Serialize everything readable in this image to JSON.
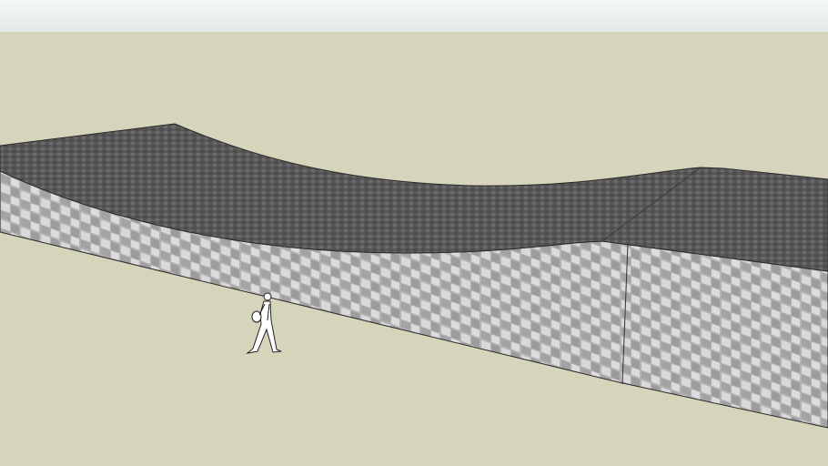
{
  "colors": {
    "sky_top": "#f4f7f8",
    "sky_bottom": "#e3e8e8",
    "ground": "#d6d4bb",
    "roof": "#585858",
    "roof_tile": "#6a6a6a",
    "wall": "#b4b4b4",
    "wall_tile": "#d8d8d8",
    "edge": "#2a2a2a"
  }
}
